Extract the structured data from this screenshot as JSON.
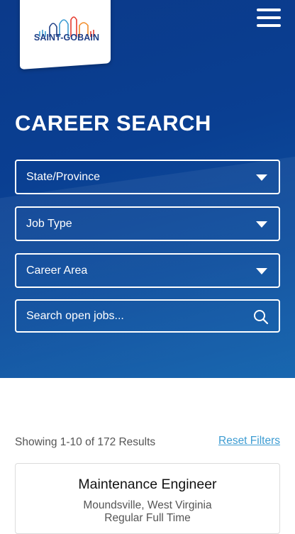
{
  "brand": {
    "logo_text": "SAINT-GOBAIN",
    "primary_color": "#0b3a8a",
    "link_color": "#3d9cd2"
  },
  "header": {
    "menu_icon": "hamburger-menu-icon"
  },
  "hero": {
    "title": "CAREER SEARCH",
    "filters": [
      {
        "label": "State/Province"
      },
      {
        "label": "Job Type"
      },
      {
        "label": "Career Area"
      }
    ],
    "search": {
      "placeholder": "Search open jobs...",
      "icon": "search-icon"
    }
  },
  "results": {
    "summary": "Showing 1-10 of 172 Results",
    "reset_label": "Reset Filters",
    "jobs": [
      {
        "title": "Maintenance Engineer",
        "location": "Moundsville, West Virginia",
        "type": "Regular Full Time"
      }
    ]
  }
}
